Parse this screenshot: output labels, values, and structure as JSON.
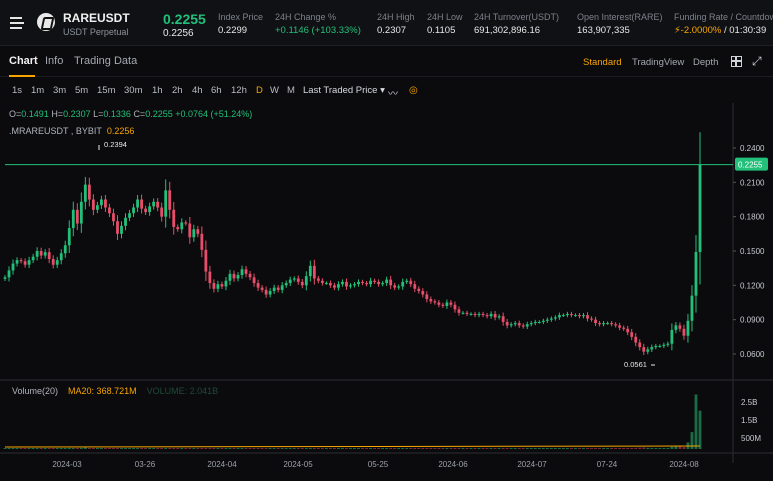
{
  "header": {
    "symbol": "RAREUSDT",
    "contract_type": "USDT Perpetual",
    "last_price": "0.2255",
    "mark_price": "0.2256",
    "stats": [
      {
        "label": "Index Price",
        "value": "0.2299",
        "style": "plain"
      },
      {
        "label": "24H Change %",
        "value": "+0.1146 (+103.33%)",
        "style": "green"
      },
      {
        "label": "24H High",
        "value": "0.2307",
        "style": "plain"
      },
      {
        "label": "24H Low",
        "value": "0.1105",
        "style": "plain"
      },
      {
        "label": "24H Turnover(USDT)",
        "value": "691,302,896.16",
        "style": "plain"
      },
      {
        "label": "Open Interest(RARE)",
        "value": "163,907,335",
        "style": "plain"
      },
      {
        "label": "Funding Rate / Countdown",
        "value_rate": "-2.0000%",
        "value_countdown": " / 01:30:39",
        "style": "funding"
      }
    ]
  },
  "tabs": {
    "left": [
      "Chart",
      "Info",
      "Trading Data"
    ],
    "active": "Chart",
    "right": [
      "Standard",
      "TradingView",
      "Depth"
    ],
    "right_active": "Standard"
  },
  "toolbar": {
    "timeframes": [
      "1s",
      "1m",
      "3m",
      "5m",
      "15m",
      "30m",
      "1h",
      "2h",
      "4h",
      "6h",
      "12h",
      "D",
      "W",
      "M"
    ],
    "active_timeframe": "D",
    "price_source": "Last Traded Price ▾",
    "icons": [
      "line-tool-icon",
      "indicator-icon"
    ]
  },
  "legend": {
    "o_label": "O=",
    "o": "0.1491",
    "h_label": "H=",
    "h": "0.2307",
    "l_label": "L=",
    "l": "0.1336",
    "c_label": "C=",
    "c": "0.2255",
    "change": "+0.0764 (+51.24%)",
    "indicator_name": ".MRAREUSDT , BYBIT",
    "indicator_value": "0.2256",
    "volume_name": "Volume(20)",
    "ma_text": "MA20: 368.721M",
    "volume_value": "VOLUME: 2.041B"
  },
  "colors": {
    "up": "#22c07a",
    "down": "#e64e6a",
    "accent": "#f7a600",
    "price_line": "#22c07a"
  },
  "chart_data": {
    "type": "candlestick",
    "price_axis_ticks": [
      "0.2400",
      "0.2100",
      "0.1800",
      "0.1500",
      "0.1200",
      "0.0900",
      "0.0600"
    ],
    "volume_axis_ticks": [
      "2.5B",
      "1.5B",
      "500M"
    ],
    "date_ticks": [
      "2024-03",
      "03-26",
      "2024-04",
      "2024-05",
      "05-25",
      "2024-06",
      "2024-07",
      "07-24",
      "2024-08"
    ],
    "ylim": [
      0.045,
      0.255
    ],
    "last_price_label": "0.2255",
    "high_annotation": "0.2394",
    "low_annotation": "0.0561",
    "close_series": [
      0.127,
      0.133,
      0.139,
      0.142,
      0.141,
      0.138,
      0.142,
      0.145,
      0.15,
      0.146,
      0.149,
      0.143,
      0.138,
      0.142,
      0.148,
      0.155,
      0.17,
      0.186,
      0.174,
      0.193,
      0.208,
      0.195,
      0.186,
      0.19,
      0.195,
      0.188,
      0.183,
      0.176,
      0.165,
      0.172,
      0.179,
      0.183,
      0.188,
      0.195,
      0.187,
      0.184,
      0.189,
      0.193,
      0.188,
      0.18,
      0.203,
      0.186,
      0.171,
      0.169,
      0.175,
      0.174,
      0.162,
      0.169,
      0.165,
      0.151,
      0.132,
      0.122,
      0.117,
      0.121,
      0.119,
      0.124,
      0.13,
      0.126,
      0.129,
      0.134,
      0.13,
      0.127,
      0.122,
      0.118,
      0.116,
      0.112,
      0.115,
      0.118,
      0.116,
      0.12,
      0.122,
      0.125,
      0.126,
      0.123,
      0.12,
      0.128,
      0.137,
      0.126,
      0.124,
      0.122,
      0.122,
      0.12,
      0.118,
      0.121,
      0.123,
      0.119,
      0.12,
      0.121,
      0.123,
      0.122,
      0.121,
      0.124,
      0.123,
      0.121,
      0.122,
      0.125,
      0.12,
      0.118,
      0.119,
      0.123,
      0.124,
      0.121,
      0.117,
      0.115,
      0.112,
      0.108,
      0.106,
      0.105,
      0.103,
      0.102,
      0.105,
      0.103,
      0.099,
      0.096,
      0.096,
      0.095,
      0.095,
      0.094,
      0.095,
      0.094,
      0.093,
      0.095,
      0.092,
      0.093,
      0.088,
      0.085,
      0.086,
      0.087,
      0.085,
      0.084,
      0.086,
      0.087,
      0.088,
      0.088,
      0.089,
      0.09,
      0.091,
      0.092,
      0.094,
      0.094,
      0.095,
      0.094,
      0.094,
      0.093,
      0.094,
      0.091,
      0.09,
      0.087,
      0.086,
      0.087,
      0.087,
      0.086,
      0.085,
      0.083,
      0.082,
      0.079,
      0.075,
      0.07,
      0.066,
      0.062,
      0.064,
      0.066,
      0.067,
      0.067,
      0.068,
      0.069,
      0.081,
      0.085,
      0.082,
      0.076,
      0.089,
      0.111,
      0.1491,
      0.2255
    ],
    "volume_series_billions": [
      0.02,
      0.02,
      0.02,
      0.02,
      0.02,
      0.02,
      0.02,
      0.02,
      0.02,
      0.02,
      0.02,
      0.02,
      0.02,
      0.02,
      0.03,
      0.05,
      0.06,
      0.05,
      0.05,
      0.06,
      0.08,
      0.05,
      0.04,
      0.03,
      0.03,
      0.03,
      0.03,
      0.03,
      0.03,
      0.03,
      0.03,
      0.03,
      0.03,
      0.03,
      0.03,
      0.03,
      0.03,
      0.03,
      0.03,
      0.03,
      0.05,
      0.03,
      0.03,
      0.03,
      0.03,
      0.03,
      0.03,
      0.03,
      0.03,
      0.03,
      0.03,
      0.03,
      0.03,
      0.03,
      0.03,
      0.03,
      0.03,
      0.03,
      0.03,
      0.03,
      0.03,
      0.03,
      0.03,
      0.03,
      0.03,
      0.03,
      0.03,
      0.03,
      0.03,
      0.03,
      0.03,
      0.03,
      0.03,
      0.03,
      0.03,
      0.03,
      0.04,
      0.03,
      0.03,
      0.03,
      0.03,
      0.03,
      0.03,
      0.03,
      0.03,
      0.03,
      0.03,
      0.03,
      0.03,
      0.03,
      0.03,
      0.03,
      0.03,
      0.03,
      0.03,
      0.03,
      0.03,
      0.03,
      0.03,
      0.03,
      0.03,
      0.03,
      0.03,
      0.03,
      0.03,
      0.03,
      0.03,
      0.03,
      0.03,
      0.03,
      0.03,
      0.03,
      0.03,
      0.03,
      0.03,
      0.03,
      0.03,
      0.03,
      0.03,
      0.03,
      0.03,
      0.03,
      0.03,
      0.03,
      0.03,
      0.03,
      0.03,
      0.03,
      0.03,
      0.03,
      0.03,
      0.03,
      0.03,
      0.03,
      0.03,
      0.03,
      0.03,
      0.03,
      0.03,
      0.03,
      0.03,
      0.03,
      0.03,
      0.03,
      0.03,
      0.03,
      0.03,
      0.03,
      0.03,
      0.03,
      0.03,
      0.03,
      0.03,
      0.03,
      0.03,
      0.04,
      0.05,
      0.06,
      0.07,
      0.08,
      0.06,
      0.05,
      0.05,
      0.05,
      0.05,
      0.05,
      0.12,
      0.18,
      0.14,
      0.1,
      0.35,
      0.9,
      2.9,
      2.04
    ]
  }
}
